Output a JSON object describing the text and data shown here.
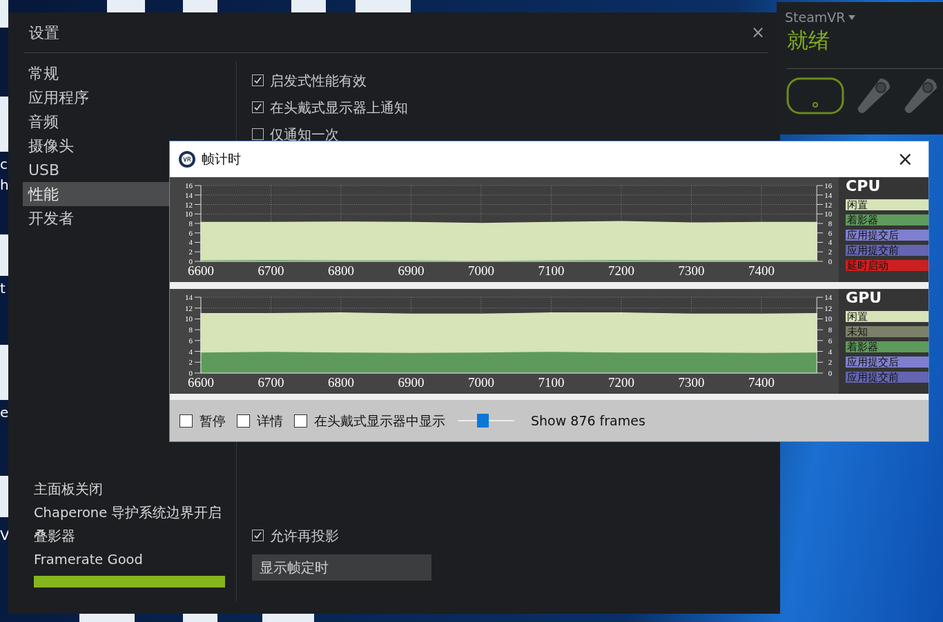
{
  "desktop": {
    "icon_labels": [
      "c",
      "h",
      "t",
      "e",
      "V"
    ]
  },
  "settings": {
    "title": "设置",
    "close": "×",
    "nav": [
      {
        "label": "常规",
        "selected": false
      },
      {
        "label": "应用程序",
        "selected": false
      },
      {
        "label": "音频",
        "selected": false
      },
      {
        "label": "摄像头",
        "selected": false
      },
      {
        "label": "USB",
        "selected": false
      },
      {
        "label": "性能",
        "selected": true
      },
      {
        "label": "开发者",
        "selected": false
      }
    ],
    "options": [
      {
        "label": "启发式性能有效",
        "checked": true
      },
      {
        "label": "在头戴式显示器上通知",
        "checked": true
      },
      {
        "label": "仅通知一次",
        "checked": false
      }
    ],
    "status_lines": [
      "主面板关闭",
      "Chaperone 导护系统边界开启",
      "叠影器",
      "Framerate Good"
    ],
    "framerate_meter": {
      "level": 1.0
    },
    "reprojection": {
      "label": "允许再投影",
      "checked": true
    },
    "show_timing_button": "显示帧定时"
  },
  "steamvr": {
    "title": "SteamVR",
    "status": "就绪",
    "devices": [
      {
        "kind": "headset",
        "active": true
      },
      {
        "kind": "controller",
        "active": false
      },
      {
        "kind": "controller",
        "active": false
      }
    ]
  },
  "frame_timing": {
    "title": "帧计时",
    "close": "×",
    "panels": [
      {
        "title": "CPU",
        "chart_data": {
          "type": "area",
          "stacked": true,
          "grid": true,
          "x": [
            6600,
            6700,
            6800,
            6900,
            7000,
            7100,
            7200,
            7300,
            7400,
            7479
          ],
          "xlim": [
            6600,
            7479
          ],
          "ylim": [
            0,
            16
          ],
          "xticks": [
            6600,
            6700,
            6800,
            6900,
            7000,
            7100,
            7200,
            7300,
            7400
          ],
          "yticks": [
            0,
            2,
            4,
            6,
            8,
            10,
            12,
            14,
            16
          ],
          "y2lim": [
            0,
            16
          ],
          "y2ticks": [
            0,
            2,
            4,
            6,
            8,
            10,
            12,
            14,
            16
          ],
          "series": [
            {
              "name": "闲置",
              "color": "#d6e4b8",
              "values": [
                7.9,
                7.8,
                8.0,
                7.9,
                7.8,
                7.9,
                8.0,
                7.8,
                7.9,
                7.9
              ]
            },
            {
              "name": "着影器",
              "color": "#5e9a5c",
              "values": [
                0.3,
                0.4,
                0.3,
                0.3,
                0.2,
                0.3,
                0.4,
                0.3,
                0.3,
                0.3
              ]
            },
            {
              "name": "应用提交后",
              "color": "#7f7fd0",
              "values": [
                null,
                null,
                null,
                null,
                null,
                null,
                null,
                null,
                null,
                null
              ]
            },
            {
              "name": "应用提交前",
              "color": "#6464b0",
              "values": [
                null,
                null,
                null,
                null,
                null,
                null,
                null,
                null,
                null,
                null
              ]
            },
            {
              "name": "延时启动",
              "color": "#cc2020",
              "values": [
                null,
                null,
                null,
                null,
                null,
                null,
                null,
                null,
                null,
                null
              ]
            }
          ]
        }
      },
      {
        "title": "GPU",
        "chart_data": {
          "type": "area",
          "stacked": true,
          "grid": true,
          "x": [
            6600,
            6700,
            6800,
            6900,
            7000,
            7100,
            7200,
            7300,
            7400,
            7479
          ],
          "xlim": [
            6600,
            7479
          ],
          "ylim": [
            0,
            14
          ],
          "xticks": [
            6600,
            6700,
            6800,
            6900,
            7000,
            7100,
            7200,
            7300,
            7400
          ],
          "yticks": [
            0,
            2,
            4,
            6,
            8,
            10,
            12,
            14
          ],
          "y2lim": [
            0,
            14
          ],
          "y2ticks": [
            0,
            2,
            4,
            6,
            8,
            10,
            12,
            14
          ],
          "series": [
            {
              "name": "闲置",
              "color": "#d6e4b8",
              "values": [
                7.1,
                7.0,
                7.2,
                7.1,
                7.0,
                7.1,
                7.2,
                7.0,
                7.1,
                7.1
              ]
            },
            {
              "name": "未知",
              "color": "#7c8068",
              "values": [
                null,
                null,
                null,
                null,
                null,
                null,
                null,
                null,
                null,
                null
              ]
            },
            {
              "name": "着影器",
              "color": "#5e9a5c",
              "values": [
                3.9,
                4.0,
                3.9,
                3.8,
                3.9,
                4.0,
                3.9,
                3.9,
                3.8,
                3.9
              ]
            },
            {
              "name": "应用提交后",
              "color": "#7f7fd0",
              "values": [
                null,
                null,
                null,
                null,
                null,
                null,
                null,
                null,
                null,
                null
              ]
            },
            {
              "name": "应用提交前",
              "color": "#6464b0",
              "values": [
                null,
                null,
                null,
                null,
                null,
                null,
                null,
                null,
                null,
                null
              ]
            }
          ]
        }
      }
    ],
    "checkboxes": [
      {
        "label": "暂停",
        "checked": false
      },
      {
        "label": "详情",
        "checked": false
      },
      {
        "label": "在头戴式显示器中显示",
        "checked": false
      }
    ],
    "frames_slider": {
      "level": 0.44
    },
    "frames_label": "Show 876 frames"
  }
}
